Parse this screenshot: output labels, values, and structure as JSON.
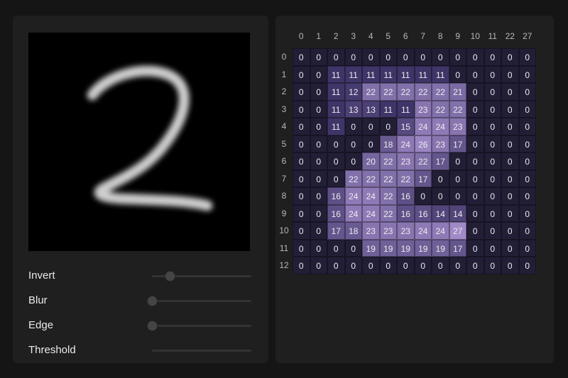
{
  "controls": [
    {
      "label": "Invert",
      "value": 0.18
    },
    {
      "label": "Blur",
      "value": 0.0
    },
    {
      "label": "Edge",
      "value": 0.0
    },
    {
      "label": "Threshold",
      "value": null
    }
  ],
  "grid": {
    "col_labels": [
      "0",
      "1",
      "2",
      "3",
      "4",
      "5",
      "6",
      "7",
      "8",
      "9",
      "10",
      "11",
      "22",
      "27"
    ],
    "row_labels": [
      "0",
      "1",
      "2",
      "3",
      "4",
      "5",
      "6",
      "7",
      "8",
      "9",
      "10",
      "11",
      "12"
    ],
    "cells": [
      [
        0,
        0,
        0,
        0,
        0,
        0,
        0,
        0,
        0,
        0,
        0,
        0,
        0,
        0
      ],
      [
        0,
        0,
        11,
        11,
        11,
        11,
        11,
        11,
        11,
        0,
        0,
        0,
        0,
        0
      ],
      [
        0,
        0,
        11,
        12,
        22,
        22,
        22,
        22,
        22,
        21,
        0,
        0,
        0,
        0
      ],
      [
        0,
        0,
        11,
        13,
        13,
        11,
        11,
        23,
        22,
        22,
        0,
        0,
        0,
        0
      ],
      [
        0,
        0,
        11,
        0,
        0,
        0,
        15,
        24,
        24,
        23,
        0,
        0,
        0,
        0
      ],
      [
        0,
        0,
        0,
        0,
        0,
        18,
        24,
        26,
        23,
        17,
        0,
        0,
        0,
        0
      ],
      [
        0,
        0,
        0,
        0,
        20,
        22,
        23,
        22,
        17,
        0,
        0,
        0,
        0,
        0
      ],
      [
        0,
        0,
        0,
        22,
        22,
        22,
        22,
        17,
        0,
        0,
        0,
        0,
        0,
        0
      ],
      [
        0,
        0,
        16,
        24,
        24,
        22,
        16,
        0,
        0,
        0,
        0,
        0,
        0,
        0
      ],
      [
        0,
        0,
        16,
        24,
        24,
        22,
        16,
        16,
        14,
        14,
        0,
        0,
        0,
        0
      ],
      [
        0,
        0,
        17,
        18,
        23,
        23,
        23,
        24,
        24,
        27,
        0,
        0,
        0,
        0
      ],
      [
        0,
        0,
        0,
        0,
        19,
        19,
        19,
        19,
        19,
        17,
        0,
        0,
        0,
        0
      ],
      [
        0,
        0,
        0,
        0,
        0,
        0,
        0,
        0,
        0,
        0,
        0,
        0,
        0,
        0
      ]
    ]
  }
}
